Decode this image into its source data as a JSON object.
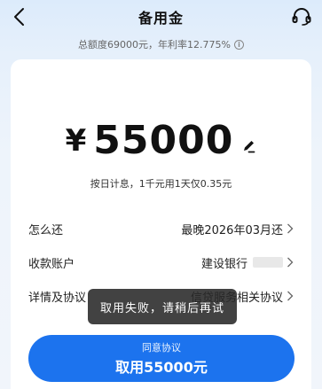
{
  "nav": {
    "title": "备用金",
    "back_icon": "chevron-left-icon",
    "service_icon": "headset-icon"
  },
  "summary": {
    "text": "总额度69000元，年利率12.775%",
    "info_icon_glyph": "i"
  },
  "amount": {
    "currency": "¥",
    "value": "55000",
    "edit_icon": "pencil-icon"
  },
  "interest_note": "按日计息，1千元用1天仅0.35元",
  "rows": [
    {
      "label": "怎么还",
      "value": "最晚2026年03月还"
    },
    {
      "label": "收款账户",
      "value": "建设银行"
    },
    {
      "label": "详情及协议",
      "value": "信贷服务相关协议"
    }
  ],
  "toast": "取用失败，请稍后再试",
  "cta": {
    "top": "同意协议",
    "main": "取用55000元"
  },
  "colors": {
    "primary": "#1c73ee",
    "toast_bg": "#282828"
  }
}
